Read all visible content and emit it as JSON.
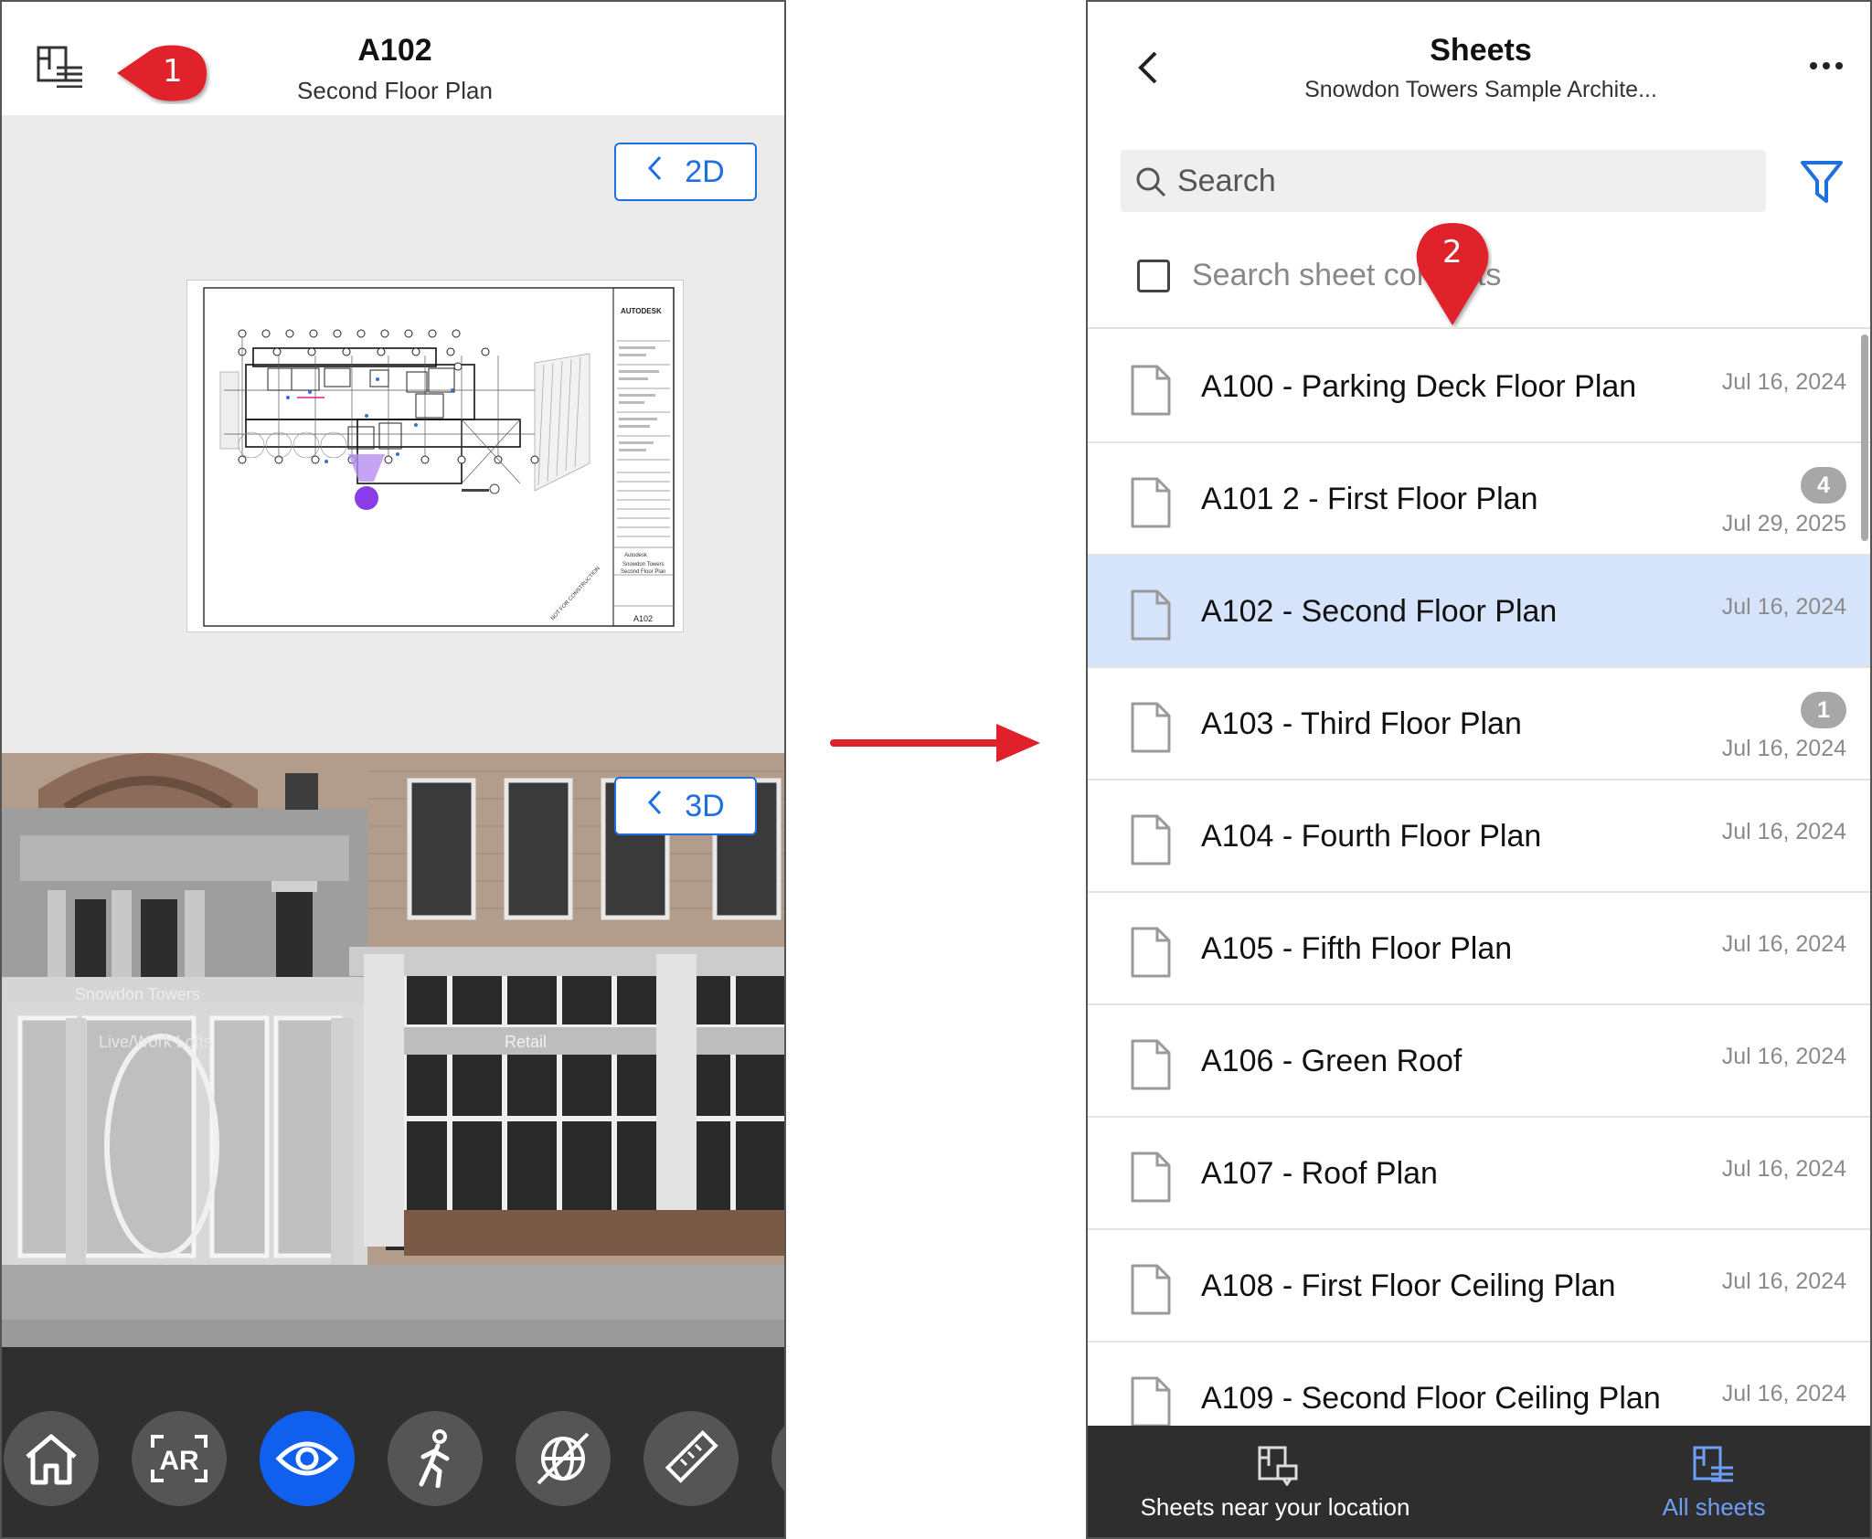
{
  "left": {
    "title": "A102",
    "subtitle": "Second Floor Plan",
    "callout_1": "1",
    "view_2d_label": "2D",
    "view_3d_label": "3D",
    "sheet_brand": "AUTODESK",
    "sheet_number": "A102",
    "sheet_stamp": "NOT FOR CONSTRUCTION",
    "title_block": [
      "Autodesk",
      "Snowdon Towers",
      "Second Floor Plan"
    ],
    "building_signs": [
      "Snowdon Towers",
      "Live/Work Lofts",
      "Retail"
    ],
    "toolbar": [
      {
        "name": "home-icon",
        "active": false
      },
      {
        "name": "ar-icon",
        "label": "AR",
        "active": false
      },
      {
        "name": "eye-icon",
        "active": true
      },
      {
        "name": "walk-icon",
        "active": false
      },
      {
        "name": "orbit-icon",
        "active": false
      },
      {
        "name": "measure-icon",
        "active": false
      }
    ]
  },
  "right": {
    "title": "Sheets",
    "subtitle": "Snowdon Towers Sample Archite...",
    "search_placeholder": "Search",
    "search_contents_label": "Search sheet contents",
    "callout_2": "2",
    "sheets": [
      {
        "name": "A100 - Parking Deck Floor Plan",
        "date": "Jul 16, 2024",
        "badge": null,
        "selected": false
      },
      {
        "name": "A101 2 - First Floor Plan",
        "date": "Jul 29, 2025",
        "badge": "4",
        "selected": false
      },
      {
        "name": "A102 - Second Floor Plan",
        "date": "Jul 16, 2024",
        "badge": null,
        "selected": true
      },
      {
        "name": "A103 - Third Floor Plan",
        "date": "Jul 16, 2024",
        "badge": "1",
        "selected": false
      },
      {
        "name": "A104 - Fourth Floor Plan",
        "date": "Jul 16, 2024",
        "badge": null,
        "selected": false
      },
      {
        "name": "A105 - Fifth Floor Plan",
        "date": "Jul 16, 2024",
        "badge": null,
        "selected": false
      },
      {
        "name": "A106 - Green Roof",
        "date": "Jul 16, 2024",
        "badge": null,
        "selected": false
      },
      {
        "name": "A107 - Roof Plan",
        "date": "Jul 16, 2024",
        "badge": null,
        "selected": false
      },
      {
        "name": "A108 - First Floor Ceiling Plan",
        "date": "Jul 16, 2024",
        "badge": null,
        "selected": false
      },
      {
        "name": "A109 - Second Floor Ceiling Plan",
        "date": "Jul 16, 2024",
        "badge": null,
        "selected": false
      }
    ],
    "bottom_nav": {
      "near_label": "Sheets near your location",
      "all_label": "All sheets"
    }
  },
  "colors": {
    "accent_blue": "#1e6fe0",
    "active_tool": "#1060f0",
    "callout_red": "#e0202a",
    "selected_row": "#d6e4fb",
    "nav_active": "#6f9ef7"
  }
}
